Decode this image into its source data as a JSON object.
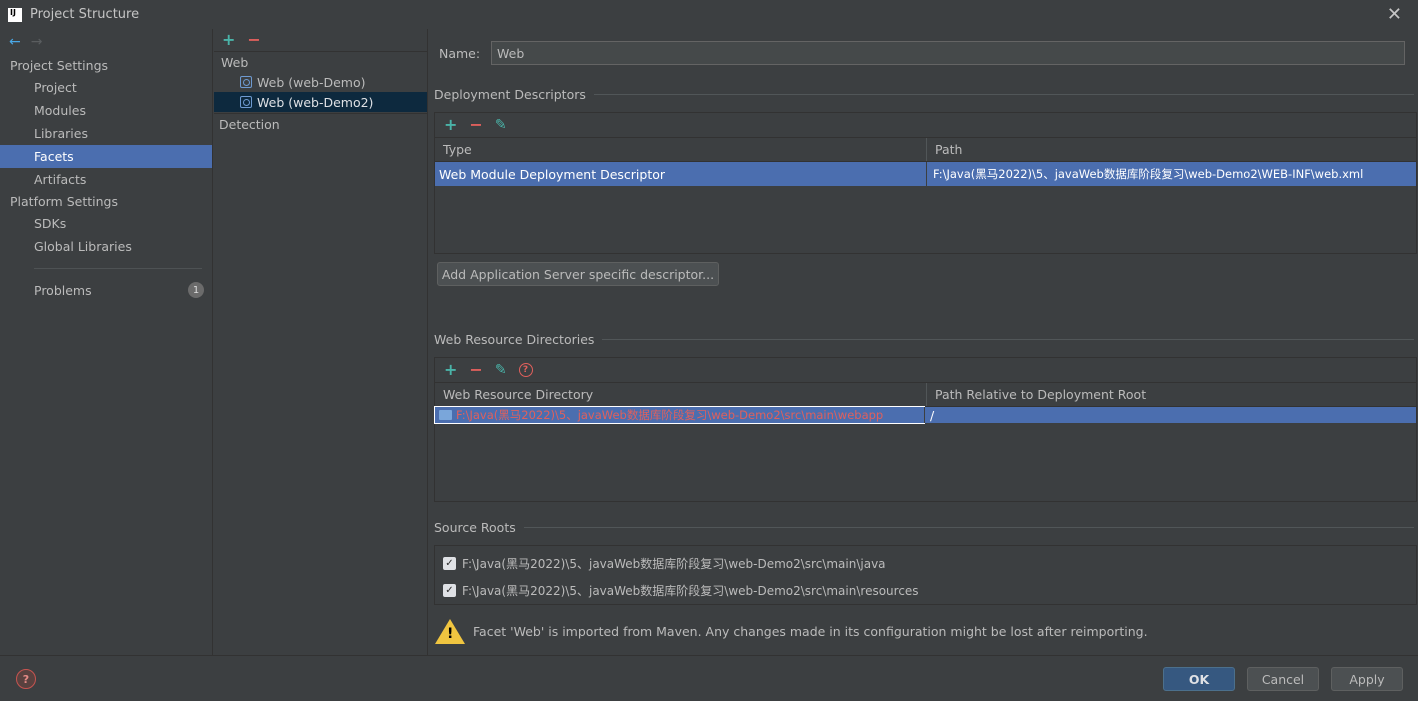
{
  "window": {
    "title": "Project Structure",
    "logo": "IJ"
  },
  "nav": {
    "back": "←",
    "forward": "→"
  },
  "sidebar": {
    "project_settings_header": "Project Settings",
    "project_items": [
      "Project",
      "Modules",
      "Libraries",
      "Facets",
      "Artifacts"
    ],
    "selected": "Facets",
    "platform_settings_header": "Platform Settings",
    "platform_items": [
      "SDKs",
      "Global Libraries"
    ],
    "problems_label": "Problems",
    "problems_count": "1"
  },
  "tree": {
    "root": "Web",
    "children": [
      "Web (web-Demo)",
      "Web (web-Demo2)"
    ],
    "selected": "Web (web-Demo2)",
    "detection": "Detection"
  },
  "main": {
    "name_label": "Name:",
    "name_value": "Web",
    "deployment_descriptors": {
      "title": "Deployment Descriptors",
      "columns": [
        "Type",
        "Path"
      ],
      "rows": [
        {
          "type": "Web Module Deployment Descriptor",
          "path": "F:\\Java(黑马2022)\\5、javaWeb数据库阶段复习\\web-Demo2\\WEB-INF\\web.xml"
        }
      ],
      "add_button": "Add Application Server specific descriptor..."
    },
    "web_resource_directories": {
      "title": "Web Resource Directories",
      "columns": [
        "Web Resource Directory",
        "Path Relative to Deployment Root"
      ],
      "rows": [
        {
          "directory": "F:\\Java(黑马2022)\\5、javaWeb数据库阶段复习\\web-Demo2\\src\\main\\webapp",
          "relative": "/"
        }
      ]
    },
    "source_roots": {
      "title": "Source Roots",
      "items": [
        {
          "path": "F:\\Java(黑马2022)\\5、javaWeb数据库阶段复习\\web-Demo2\\src\\main\\java",
          "checked": true
        },
        {
          "path": "F:\\Java(黑马2022)\\5、javaWeb数据库阶段复习\\web-Demo2\\src\\main\\resources",
          "checked": true
        }
      ]
    },
    "warning": "Facet 'Web' is imported from Maven. Any changes made in its configuration might be lost after reimporting."
  },
  "buttons": {
    "ok": "OK",
    "cancel": "Cancel",
    "apply": "Apply"
  },
  "colors": {
    "selection": "#4b6eaf",
    "accent_add": "#4ab3a8",
    "accent_remove": "#e0605c",
    "warning": "#f0c540"
  }
}
